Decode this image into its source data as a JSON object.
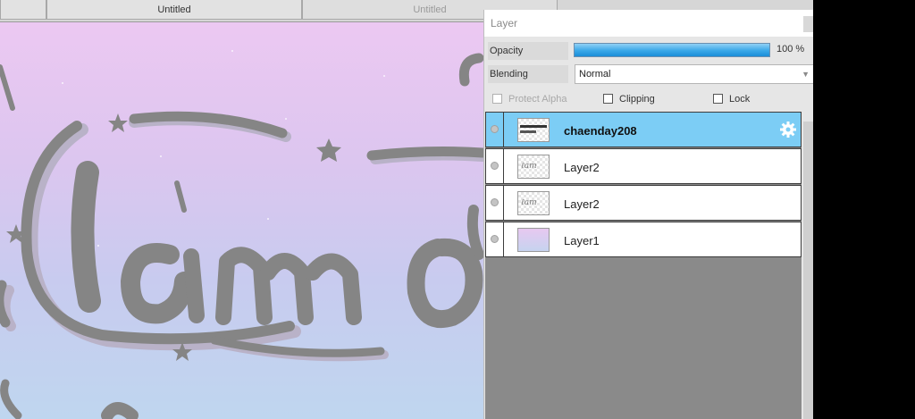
{
  "tabs": [
    {
      "label": "Untitled",
      "active": true
    },
    {
      "label": "Untitled",
      "active": false
    }
  ],
  "layer_panel": {
    "title": "Layer",
    "opacity": {
      "label": "Opacity",
      "value": 100,
      "display": "100 %"
    },
    "blending": {
      "label": "Blending",
      "value": "Normal"
    },
    "options": {
      "protect_alpha": {
        "label": "Protect Alpha",
        "checked": false,
        "enabled": false
      },
      "clipping": {
        "label": "Clipping",
        "checked": false,
        "enabled": true
      },
      "lock": {
        "label": "Lock",
        "checked": false,
        "enabled": true
      }
    },
    "layers": [
      {
        "name": "chaenday208",
        "selected": true,
        "thumb": "text"
      },
      {
        "name": "Layer2",
        "selected": false,
        "thumb": "lettering"
      },
      {
        "name": "Layer2",
        "selected": false,
        "thumb": "lettering"
      },
      {
        "name": "Layer1",
        "selected": false,
        "thumb": "gradient"
      }
    ],
    "icons": {
      "settings": "gear-icon",
      "visibility": "eye-icon"
    }
  },
  "colors": {
    "selected_layer": "#7ccdf5",
    "opacity_fill": "#3aa8e8",
    "lettering": "#858585",
    "canvas_top": "#ecc8f2",
    "canvas_bottom": "#bfd6ef"
  }
}
